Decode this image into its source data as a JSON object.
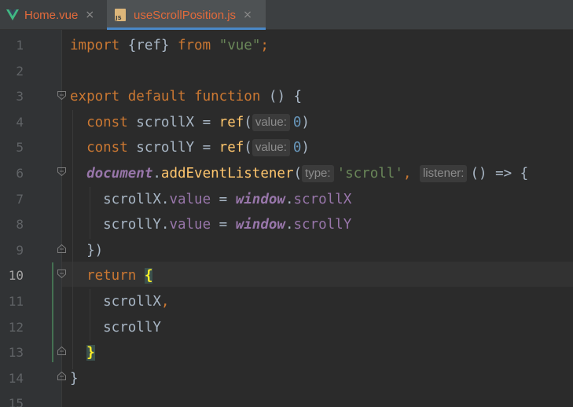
{
  "tabs": [
    {
      "label": "Home.vue",
      "close": "×",
      "icon": "vue-icon",
      "active": false
    },
    {
      "label": "useScrollPosition.js",
      "close": "×",
      "icon": "js-icon",
      "icon_text": "JS",
      "active": true
    }
  ],
  "editor": {
    "line_numbers": [
      "1",
      "2",
      "3",
      "4",
      "5",
      "6",
      "7",
      "8",
      "9",
      "10",
      "11",
      "12",
      "13",
      "14",
      "15"
    ],
    "current_line": 10,
    "code": {
      "l1": {
        "t1": "import",
        "t2": " {",
        "t3": "ref",
        "t4": "} ",
        "t5": "from",
        "t6": " ",
        "t7": "\"vue\"",
        "t8": ";"
      },
      "l3": {
        "t1": "export",
        "t2": " ",
        "t3": "default",
        "t4": " ",
        "t5": "function",
        "t6": " () {"
      },
      "l4": {
        "t1": "  const",
        "t2": " scrollX = ",
        "t3": "ref",
        "t4": "(",
        "hint": "value:",
        "t5": "0",
        "t6": ")"
      },
      "l5": {
        "t1": "  const",
        "t2": " scrollY = ",
        "t3": "ref",
        "t4": "(",
        "hint": "value:",
        "t5": "0",
        "t6": ")"
      },
      "l6": {
        "t1": "  document",
        "t2": ".",
        "t3": "addEventListener",
        "t4": "(",
        "hint1": "type:",
        "t5": "'scroll'",
        "t6": ", ",
        "hint2": "listener:",
        "t7": "() => {"
      },
      "l7": {
        "t1": "    scrollX.",
        "t2": "value",
        "t3": " = ",
        "t4": "window",
        "t5": ".",
        "t6": "scrollX"
      },
      "l8": {
        "t1": "    scrollY.",
        "t2": "value",
        "t3": " = ",
        "t4": "window",
        "t5": ".",
        "t6": "scrollY"
      },
      "l9": {
        "t1": "  })"
      },
      "l10": {
        "t1": "  return",
        "t2": " ",
        "t3": "{"
      },
      "l11": {
        "t1": "    scrollX",
        "t2": ","
      },
      "l12": {
        "t1": "    scrollY"
      },
      "l13": {
        "t1": "  ",
        "t2": "}"
      },
      "l14": {
        "t1": "}"
      }
    }
  },
  "colors": {
    "background": "#2b2b2b",
    "gutter": "#313335",
    "keyword": "#cc7832",
    "string": "#6a8759",
    "number": "#6897bb",
    "function": "#ffc66d",
    "property": "#9876aa",
    "text": "#a9b7c6",
    "tab_modified_text": "#e26a3b",
    "active_tab_underline": "#4a88c7",
    "vcs_changed": "#447152"
  }
}
